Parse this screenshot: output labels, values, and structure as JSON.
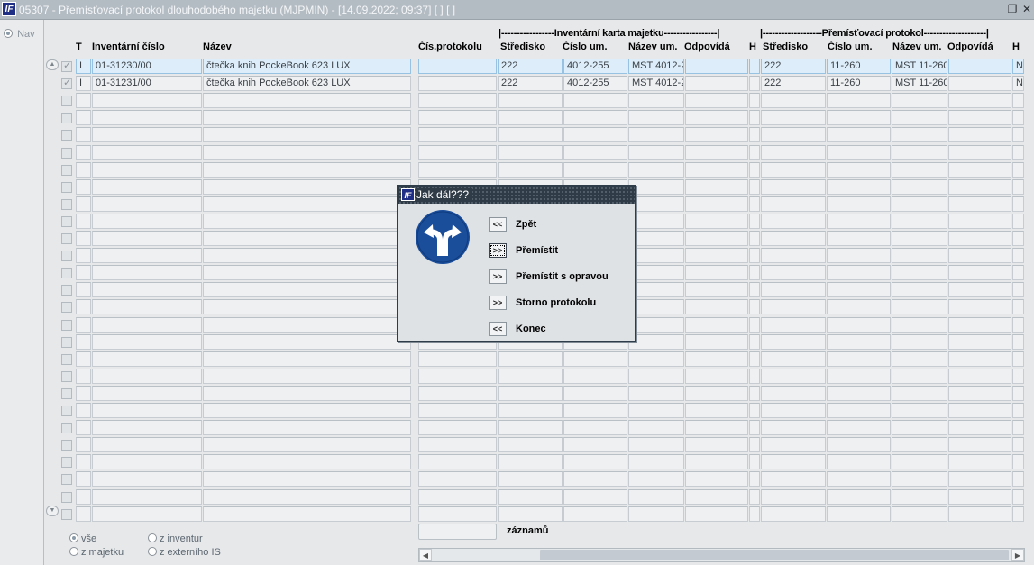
{
  "window": {
    "title": "05307 - Přemísťovací protokol dlouhodobého majetku (MJPMIN) - [14.09.2022; 09:37]  [ ]  [ ]",
    "logo_text": "IF",
    "restore_icon": "restore-icon",
    "close_icon": "close-icon"
  },
  "nav": {
    "label": "Nav"
  },
  "headers": {
    "t": "T",
    "inv_number": "Inventární číslo",
    "name": "Název",
    "protocol_no": "Čís.protokolu",
    "group_card": "|-----------------Inventární karta majetku-----------------|",
    "group_protocol": "|-------------------Přemísťovací protokol--------------------|",
    "card_center": "Středisko",
    "card_loc_no": "Číslo um.",
    "card_loc_name": "Název um.",
    "card_resp": "Odpovídá",
    "card_h": "H",
    "prot_center": "Středisko",
    "prot_loc_no": "Číslo um.",
    "prot_loc_name": "Název um.",
    "prot_resp": "Odpovídá",
    "prot_h": "H"
  },
  "rows": [
    {
      "checked": true,
      "selected": true,
      "t": "I",
      "inv_number": "01-31230/00",
      "name": "čtečka knih PockeBook 623 LUX",
      "protocol_no": "",
      "card_center": "222",
      "card_loc_no": "4012-255",
      "card_loc_name": "MST 4012-2",
      "card_resp": "",
      "card_h": "",
      "prot_center": "222",
      "prot_loc_no": "11-260",
      "prot_loc_name": "MST 11-260",
      "prot_resp": "",
      "prot_h": "N"
    },
    {
      "checked": true,
      "selected": false,
      "t": "I",
      "inv_number": "01-31231/00",
      "name": "čtečka knih PockeBook 623 LUX",
      "protocol_no": "",
      "card_center": "222",
      "card_loc_no": "4012-255",
      "card_loc_name": "MST 4012-2",
      "card_resp": "",
      "card_h": "",
      "prot_center": "222",
      "prot_loc_no": "11-260",
      "prot_loc_name": "MST 11-260",
      "prot_resp": "",
      "prot_h": "N"
    }
  ],
  "empty_row_count": 25,
  "filters": {
    "all": "vše",
    "from_inventory": "z inventur",
    "from_assets": "z majetku",
    "from_external": "z externího IS",
    "selected": "all"
  },
  "footer": {
    "count_value": "",
    "count_label": "záznamů"
  },
  "dialog": {
    "title": "Jak dál???",
    "logo_text": "IF",
    "sign_icon": "direction-sign-icon",
    "buttons": [
      {
        "arrow": "<<",
        "label": "Zpět",
        "focused": false
      },
      {
        "arrow": ">>",
        "label": "Přemístit",
        "focused": true
      },
      {
        "arrow": ">>",
        "label": "Přemístit s opravou",
        "focused": false
      },
      {
        "arrow": ">>",
        "label": "Storno protokolu",
        "focused": false
      },
      {
        "arrow": "<<",
        "label": "Konec",
        "focused": false
      }
    ]
  }
}
